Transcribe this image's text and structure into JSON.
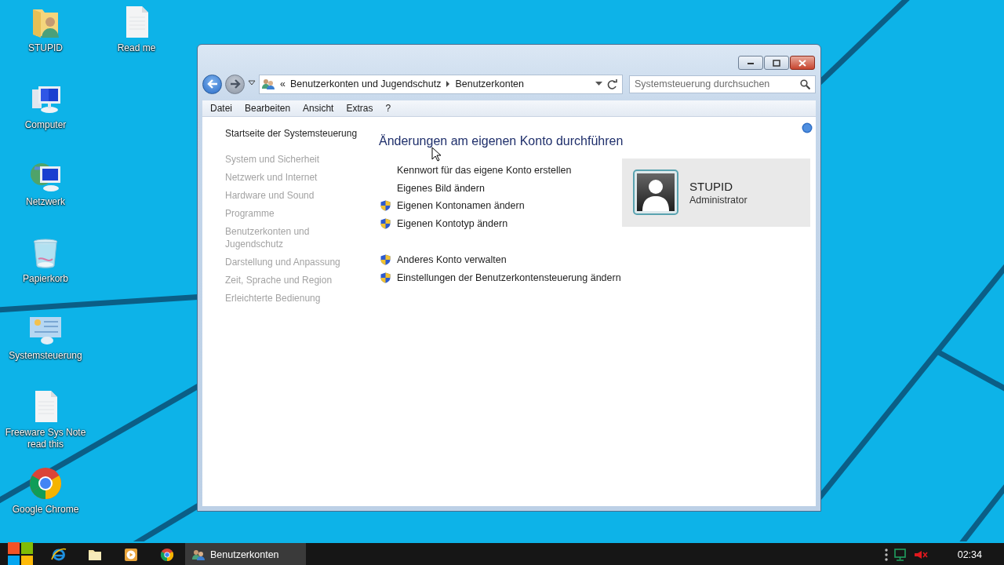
{
  "desktop_icons": [
    {
      "label": "STUPID",
      "kind": "user-folder"
    },
    {
      "label": "Computer",
      "kind": "computer"
    },
    {
      "label": "Netzwerk",
      "kind": "network"
    },
    {
      "label": "Papierkorb",
      "kind": "recycle-bin"
    },
    {
      "label": "Systemsteuerung",
      "kind": "control-panel"
    },
    {
      "label": "Freeware Sys Note read this",
      "kind": "document"
    },
    {
      "label": "Google Chrome",
      "kind": "chrome"
    },
    {
      "label": "Read me",
      "kind": "document"
    }
  ],
  "window": {
    "address": {
      "overflow": "«",
      "breadcrumbs": [
        "Benutzerkonten und Jugendschutz",
        "Benutzerkonten"
      ]
    },
    "search": {
      "placeholder": "Systemsteuerung durchsuchen"
    },
    "menu": [
      "Datei",
      "Bearbeiten",
      "Ansicht",
      "Extras",
      "?"
    ],
    "sidebar": [
      {
        "label": "Startseite der Systemsteuerung",
        "disabled": false
      },
      {
        "label": "System und Sicherheit",
        "disabled": true
      },
      {
        "label": "Netzwerk und Internet",
        "disabled": true
      },
      {
        "label": "Hardware und Sound",
        "disabled": true
      },
      {
        "label": "Programme",
        "disabled": true
      },
      {
        "label": "Benutzerkonten und Jugendschutz",
        "disabled": true
      },
      {
        "label": "Darstellung und Anpassung",
        "disabled": true
      },
      {
        "label": "Zeit, Sprache und Region",
        "disabled": true
      },
      {
        "label": "Erleichterte Bedienung",
        "disabled": true
      }
    ],
    "heading": "Änderungen am eigenen Konto durchführen",
    "task_groups": [
      [
        {
          "label": "Kennwort für das eigene Konto erstellen",
          "shield": false
        },
        {
          "label": "Eigenes Bild ändern",
          "shield": false
        },
        {
          "label": "Eigenen Kontonamen ändern",
          "shield": true
        },
        {
          "label": "Eigenen Kontotyp ändern",
          "shield": true
        }
      ],
      [
        {
          "label": "Anderes Konto verwalten",
          "shield": true
        },
        {
          "label": "Einstellungen der Benutzerkontensteuerung ändern",
          "shield": true
        }
      ]
    ],
    "account": {
      "name": "STUPID",
      "role": "Administrator"
    }
  },
  "taskbar": {
    "pinned": [
      {
        "kind": "ie"
      },
      {
        "kind": "explorer"
      },
      {
        "kind": "media"
      },
      {
        "kind": "chrome"
      }
    ],
    "tasks": [
      {
        "label": "Benutzerkonten",
        "selected": true
      }
    ],
    "tray": [
      {
        "kind": "overflow"
      },
      {
        "kind": "network"
      },
      {
        "kind": "volume-muted"
      }
    ],
    "clock": "02:34"
  }
}
